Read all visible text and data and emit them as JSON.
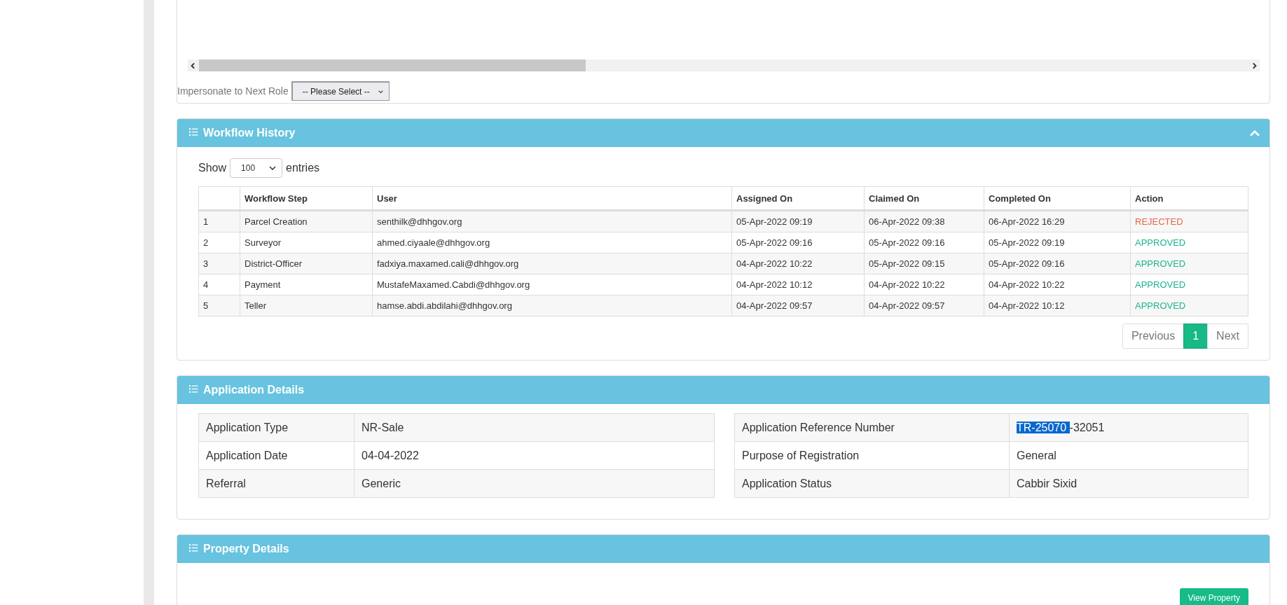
{
  "role_select": {
    "label": "Impersonate to Next Role",
    "value": "-- Please Select --"
  },
  "workflow_history": {
    "title": "Workflow History",
    "expanded": true,
    "length_menu": {
      "before": "Show",
      "value": "100",
      "after": "entries"
    },
    "columns": [
      "",
      "Workflow Step",
      "User",
      "Assigned On",
      "Claimed On",
      "Completed On",
      "Action"
    ],
    "rows": [
      {
        "no": "1",
        "step": "Parcel Creation",
        "user": "senthilk@dhhgov.org",
        "assigned": "05-Apr-2022 09:19",
        "claimed": "06-Apr-2022 09:38",
        "completed": "06-Apr-2022 16:29",
        "action": "REJECTED",
        "kind": "rejected"
      },
      {
        "no": "2",
        "step": "Surveyor",
        "user": "ahmed.ciyaale@dhhgov.org",
        "assigned": "05-Apr-2022 09:16",
        "claimed": "05-Apr-2022 09:16",
        "completed": "05-Apr-2022 09:19",
        "action": "APPROVED",
        "kind": "approved"
      },
      {
        "no": "3",
        "step": "District-Officer",
        "user": "fadxiya.maxamed.cali@dhhgov.org",
        "assigned": "04-Apr-2022 10:22",
        "claimed": "05-Apr-2022 09:15",
        "completed": "05-Apr-2022 09:16",
        "action": "APPROVED",
        "kind": "approved"
      },
      {
        "no": "4",
        "step": "Payment",
        "user": "MustafeMaxamed.Cabdi@dhhgov.org",
        "assigned": "04-Apr-2022 10:12",
        "claimed": "04-Apr-2022 10:22",
        "completed": "04-Apr-2022 10:22",
        "action": "APPROVED",
        "kind": "approved"
      },
      {
        "no": "5",
        "step": "Teller",
        "user": "hamse.abdi.abdilahi@dhhgov.org",
        "assigned": "04-Apr-2022 09:57",
        "claimed": "04-Apr-2022 09:57",
        "completed": "04-Apr-2022 10:12",
        "action": "APPROVED",
        "kind": "approved"
      }
    ],
    "pagination": [
      {
        "label": "Previous",
        "selected": false
      },
      {
        "label": "1",
        "selected": true
      },
      {
        "label": "Next",
        "selected": false
      }
    ]
  },
  "application_details": {
    "title": "Application Details",
    "left": [
      {
        "label": "Application Type",
        "value": [
          {
            "text": "NR-Sale",
            "highlighted": false
          }
        ]
      },
      {
        "label": "Application Date",
        "value": [
          {
            "text": "04-04-2022",
            "highlighted": false
          }
        ]
      },
      {
        "label": "Referral",
        "value": [
          {
            "text": "Generic",
            "highlighted": false
          }
        ]
      }
    ],
    "right": [
      {
        "label": "Application Reference Number",
        "value": [
          {
            "text": "TR-25070 ",
            "highlighted": true
          },
          {
            "text": "-32051",
            "highlighted": false
          }
        ]
      },
      {
        "label": "Purpose of Registration",
        "value": [
          {
            "text": "General",
            "highlighted": false
          }
        ]
      },
      {
        "label": "Application Status",
        "value": [
          {
            "text": "Cabbir Sixid",
            "highlighted": false
          }
        ]
      }
    ]
  },
  "property_details": {
    "title": "Property Details",
    "button": "View Property"
  }
}
